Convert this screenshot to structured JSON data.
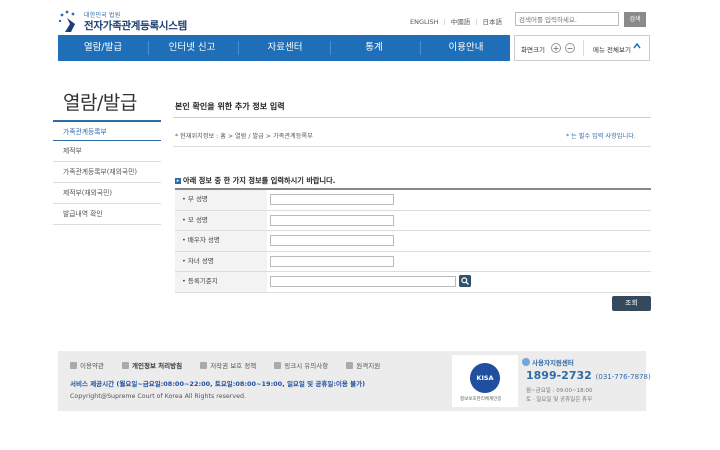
{
  "header": {
    "logo_subtitle": "대한민국 법원",
    "logo_title": "전자가족관계등록시스템",
    "languages": [
      "ENGLISH",
      "中國語",
      "日本語"
    ],
    "search_placeholder": "검색어를 입력하세요.",
    "search_button": "검색"
  },
  "nav": {
    "items": [
      "열람/발급",
      "인터넷 신고",
      "자료센터",
      "통계",
      "이용안내"
    ]
  },
  "tools": {
    "zoom_label": "화면크기",
    "zoom_in": "+",
    "zoom_out": "−",
    "menu_label": "메뉴 전체보기"
  },
  "sidebar": {
    "title": "열람/발급",
    "items": [
      "가족관계등록부",
      "제적부",
      "가족관계등록부(재외국민)",
      "제적부(재외국민)",
      "발급내역 확인"
    ]
  },
  "main": {
    "title": "본인 확인을 위한 추가 정보 입력",
    "breadcrumb": "* 현재위치정보 : 홈 > 열람 / 발급 > 가족관계등록부",
    "required_note": "* 는 필수 입력 사항입니다.",
    "instruction": "아래 정보 중 한 가지 정보를 입력하시기 바랍니다.",
    "fields": [
      "부 성명",
      "모 성명",
      "배우자 성명",
      "자녀 성명",
      "등록기준지"
    ],
    "submit": "조회"
  },
  "footer": {
    "links": [
      "이용약관",
      "개인정보 처리방침",
      "저작권 보호 정책",
      "링크시 유의사항",
      "원격지원"
    ],
    "hours": "서비스 제공시간 (월요일~금요일:08:00~22:00, 토요일:08:00~19:00, 일요일 및 공휴일:이용 불가)",
    "copyright": "Copyright@Supreme Court of Korea All Rights reserved.",
    "cert_logo": "KISA",
    "cert_text": "정보보호관리체계인증",
    "callcenter_label": "사용자지원센터",
    "phone": "1899-2732",
    "phone_alt": "(031-776-7878)",
    "hours_weekday": "월~금요일 : 09:00~18:00",
    "hours_weekend": "토 · 일요일 및 공휴일은 휴무"
  }
}
